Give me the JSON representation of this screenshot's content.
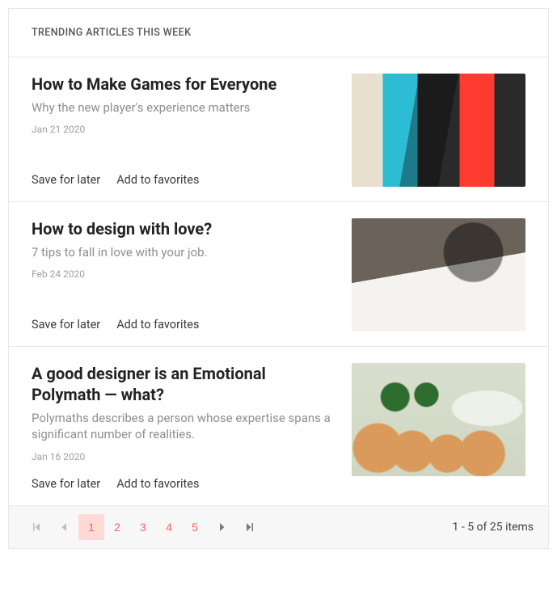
{
  "header": {
    "title": "TRENDING ARTICLES THIS WEEK"
  },
  "actions": {
    "save_label": "Save for later",
    "favorite_label": "Add to favorites"
  },
  "articles": [
    {
      "title": "How to Make Games for Everyone",
      "subtitle": "Why the new player's experience matters",
      "date": "Jan 21 2020",
      "thumb_class": "thumb-1",
      "thumb_name": "article-thumb-games"
    },
    {
      "title": "How to design with love?",
      "subtitle": "7 tips to fall in love with your job.",
      "date": "Feb 24 2020",
      "thumb_class": "thumb-2",
      "thumb_name": "article-thumb-design"
    },
    {
      "title": "A good designer is an Emotional Polymath — what?",
      "subtitle": "Polymaths describes a person whose expertise spans a significant number of realities.",
      "date": "Jan 16 2020",
      "thumb_class": "thumb-3",
      "thumb_name": "article-thumb-polymath"
    }
  ],
  "pager": {
    "pages": [
      "1",
      "2",
      "3",
      "4",
      "5"
    ],
    "current_page": 1,
    "info": "1 - 5 of 25 items",
    "total_items": 25,
    "page_size": 5
  }
}
